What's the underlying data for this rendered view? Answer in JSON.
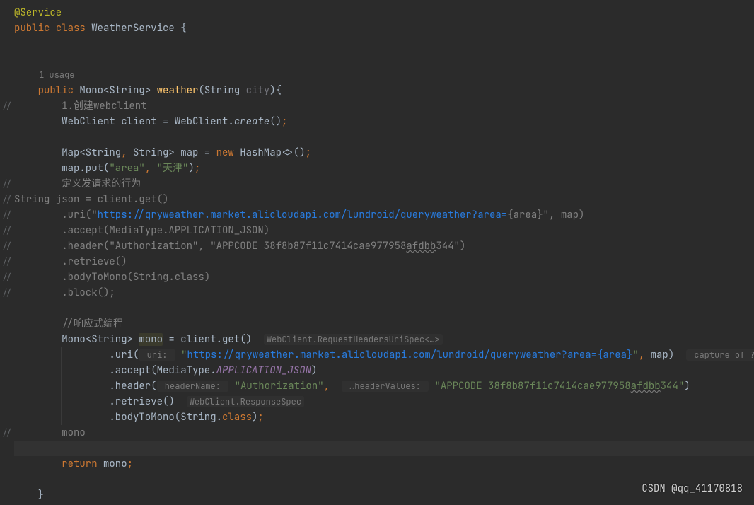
{
  "code": {
    "annotation": "@Service",
    "mod_public": "public",
    "kw_class": "class",
    "class_name": "WeatherService",
    "brace_open": "{",
    "usage_hint": "1 usage",
    "method_sig": {
      "public": "public",
      "ret1": "Mono",
      "ret2": "<String>",
      "name": "weather",
      "paren_open": "(",
      "ptype": "String",
      "pname": "city",
      "paren_close": ")",
      "brace": "{"
    },
    "cmt_line1_a": "//",
    "cmt_line1_b": "        1.创建webclient",
    "wc_decl1": "WebClient client = WebClient.",
    "wc_create": "create",
    "wc_decl2": "()",
    "wc_semi": ";",
    "map_decl1": "Map<String",
    "map_comma1": ",",
    "map_decl2": " String> map = ",
    "map_new": "new",
    "map_decl3": " HashMap<>()",
    "map_semi": ";",
    "map_put1": "map.put(",
    "map_put_k": "\"area\"",
    "map_put_c": ",",
    "map_put_v": " \"天津\"",
    "map_put2": ")",
    "map_put_semi": ";",
    "cmt2a": "//",
    "cmt2b": "        定义发请求的行为",
    "cmt3a": "//",
    "cmt3b": "String json = client.get()",
    "cmt4a": "//",
    "cmt4b": "        .uri(\"",
    "cmt4_url": "https://qryweather.market.alicloudapi.com/lundroid/queryweather?area=",
    "cmt4c": "{area}\", map)",
    "cmt5a": "//",
    "cmt5b": "        .accept(MediaType.APPLICATION_JSON)",
    "cmt6a": "//",
    "cmt6b": "        .header(\"Authorization\", \"APPCODE 38f8b87f11c7414cae977958",
    "cmt6_sq": "afdbb",
    "cmt6c": "344\")",
    "cmt7a": "//",
    "cmt7b": "        .retrieve()",
    "cmt8a": "//",
    "cmt8b": "        .bodyToMono(String.class)",
    "cmt9a": "//",
    "cmt9b": "        .block();",
    "cmt_react": "//响应式编程",
    "mono_decl1": "Mono<String> ",
    "mono_var": "mono",
    "mono_decl2": " = client.get()",
    "hint_spec": "WebClient.RequestHeadersUriSpec<…>",
    "uri1": ".uri(",
    "uri_hint": " uri: ",
    "uri_q": "\"",
    "uri_url": "https://qryweather.market.alicloudapi.com/lundroid/queryweather?area={area}",
    "uri_q2": "\"",
    "uri_c": ",",
    "uri2": " map)",
    "hint_capture": " capture of ? ",
    "accept1": ".accept(MediaType.",
    "accept_json": "APPLICATION_JSON",
    "accept2": ")",
    "header1": ".header(",
    "header_hint1": " headerName: ",
    "header_v1": "\"Authorization\"",
    "header_c": ",",
    "header_hint2": " …headerValues: ",
    "header_v2a": "\"APPCODE 38f8b87f11c7414cae977958",
    "header_sq": "afdbb",
    "header_v2b": "344\"",
    "header2": ")",
    "retrieve": ".retrieve()",
    "hint_resp": "WebClient.ResponseSpec",
    "body1": ".bodyToMono(String.",
    "body_class": "class",
    "body2": ")",
    "body_semi": ";",
    "cmt_mono_a": "//",
    "cmt_mono_b": "        mono",
    "return_kw": "return",
    "return_var": " mono",
    "return_semi": ";",
    "brace_close": "}"
  },
  "gutter": {
    "slash": "//"
  },
  "watermark": "CSDN @qq_41170818",
  "chart_data": {
    "type": "code",
    "language": "Java",
    "lines": [
      "@Service",
      "public class WeatherService {",
      "",
      "",
      "    1 usage",
      "    public Mono<String> weather(String city){",
      "//        1.创建webclient",
      "        WebClient client = WebClient.create();",
      "",
      "        Map<String, String> map = new HashMap<>();",
      "        map.put(\"area\", \"天津\");",
      "//        定义发请求的行为",
      "//String json = client.get()",
      "//        .uri(\"https://qryweather.market.alicloudapi.com/lundroid/queryweather?area={area}\", map)",
      "//        .accept(MediaType.APPLICATION_JSON)",
      "//        .header(\"Authorization\", \"APPCODE 38f8b87f11c7414cae977958afdbb344\")",
      "//        .retrieve()",
      "//        .bodyToMono(String.class)",
      "//        .block();",
      "",
      "        //响应式编程",
      "        Mono<String> mono = client.get()",
      "                .uri(\"https://qryweather.market.alicloudapi.com/lundroid/queryweather?area={area}\", map)",
      "                .accept(MediaType.APPLICATION_JSON)",
      "                .header(\"Authorization\", \"APPCODE 38f8b87f11c7414cae977958afdbb344\")",
      "                .retrieve()",
      "                .bodyToMono(String.class);",
      "//        mono",
      "",
      "        return mono;",
      "",
      "    }"
    ]
  }
}
